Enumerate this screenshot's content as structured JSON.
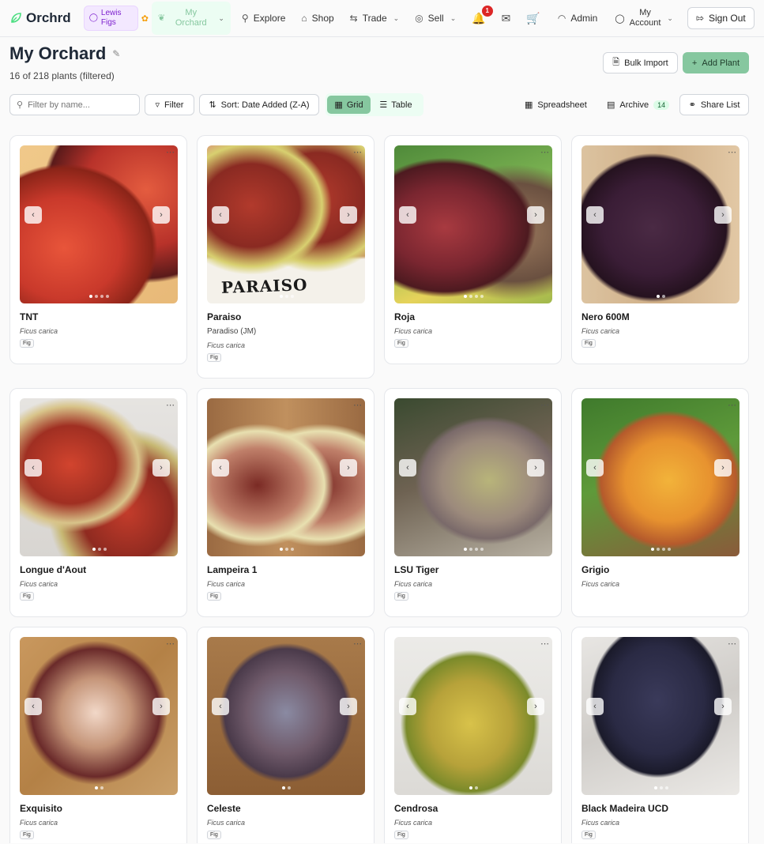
{
  "nav": {
    "logo": "Orchrd",
    "user_line1": "Lewis",
    "user_line2": "Figs",
    "orchard_line1": "My",
    "orchard_line2": "Orchard",
    "explore": "Explore",
    "shop": "Shop",
    "trade": "Trade",
    "sell": "Sell",
    "notif_count": "1",
    "admin": "Admin",
    "account_line1": "My",
    "account_line2": "Account",
    "signout": "Sign Out"
  },
  "header": {
    "title": "My Orchard",
    "subtitle": "16 of 218 plants (filtered)",
    "bulk_import": "Bulk Import",
    "add_plant": "Add Plant"
  },
  "toolbar": {
    "search_placeholder": "Filter by name...",
    "filter": "Filter",
    "sort": "Sort: Date Added (Z-A)",
    "grid": "Grid",
    "table": "Table",
    "spreadsheet": "Spreadsheet",
    "archive": "Archive",
    "archive_count": "14",
    "share_list": "Share List"
  },
  "plants": [
    {
      "name": "TNT",
      "alias": "",
      "species": "Ficus carica",
      "tag": "Fig"
    },
    {
      "name": "Paraiso",
      "alias": "Paradiso (JM)",
      "species": "Ficus carica",
      "tag": "Fig"
    },
    {
      "name": "Roja",
      "alias": "",
      "species": "Ficus carica",
      "tag": "Fig"
    },
    {
      "name": "Nero 600M",
      "alias": "",
      "species": "Ficus carica",
      "tag": "Fig"
    },
    {
      "name": "Longue d'Aout",
      "alias": "",
      "species": "Ficus carica",
      "tag": "Fig"
    },
    {
      "name": "Lampeira 1",
      "alias": "",
      "species": "Ficus carica",
      "tag": "Fig"
    },
    {
      "name": "LSU Tiger",
      "alias": "",
      "species": "Ficus carica",
      "tag": "Fig"
    },
    {
      "name": "Grigio",
      "alias": "",
      "species": "Ficus carica",
      "tag": ""
    },
    {
      "name": "Exquisito",
      "alias": "",
      "species": "Ficus carica",
      "tag": "Fig"
    },
    {
      "name": "Celeste",
      "alias": "",
      "species": "Ficus carica",
      "tag": "Fig"
    },
    {
      "name": "Cendrosa",
      "alias": "",
      "species": "Ficus carica",
      "tag": "Fig"
    },
    {
      "name": "Black Madeira UCD",
      "alias": "",
      "species": "Ficus carica",
      "tag": "Fig"
    }
  ],
  "photo_label": "PARAISO"
}
